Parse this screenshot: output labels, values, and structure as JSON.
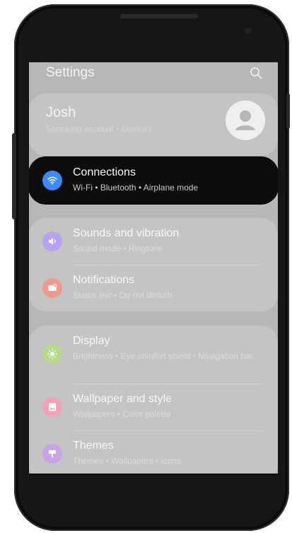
{
  "header": {
    "title": "Settings"
  },
  "account": {
    "name": "Josh",
    "subtitle": "Samsung account  •  Devices"
  },
  "items": [
    {
      "title": "Connections",
      "subtitle": "Wi-Fi  •  Bluetooth  •  Airplane mode",
      "icon": "wifi-icon",
      "color": "#3d8af7",
      "highlighted": true
    },
    {
      "title": "Sounds and vibration",
      "subtitle": "Sound mode  •  Ringtone",
      "icon": "speaker-icon",
      "color": "#b9a2f0"
    },
    {
      "title": "Notifications",
      "subtitle": "Status bar  •  Do not disturb",
      "icon": "notification-icon",
      "color": "#ee9a8e"
    },
    {
      "title": "Display",
      "subtitle": "Brightness  •  Eye comfort shield  •  Navigation bar",
      "icon": "sun-icon",
      "color": "#b6d98a"
    },
    {
      "title": "Wallpaper and style",
      "subtitle": "Wallpapers  •  Color palette",
      "icon": "wallpaper-icon",
      "color": "#f2a2b6"
    },
    {
      "title": "Themes",
      "subtitle": "Themes  •  Wallpapers  •  Icons",
      "icon": "themes-icon",
      "color": "#c9a3e8"
    }
  ]
}
